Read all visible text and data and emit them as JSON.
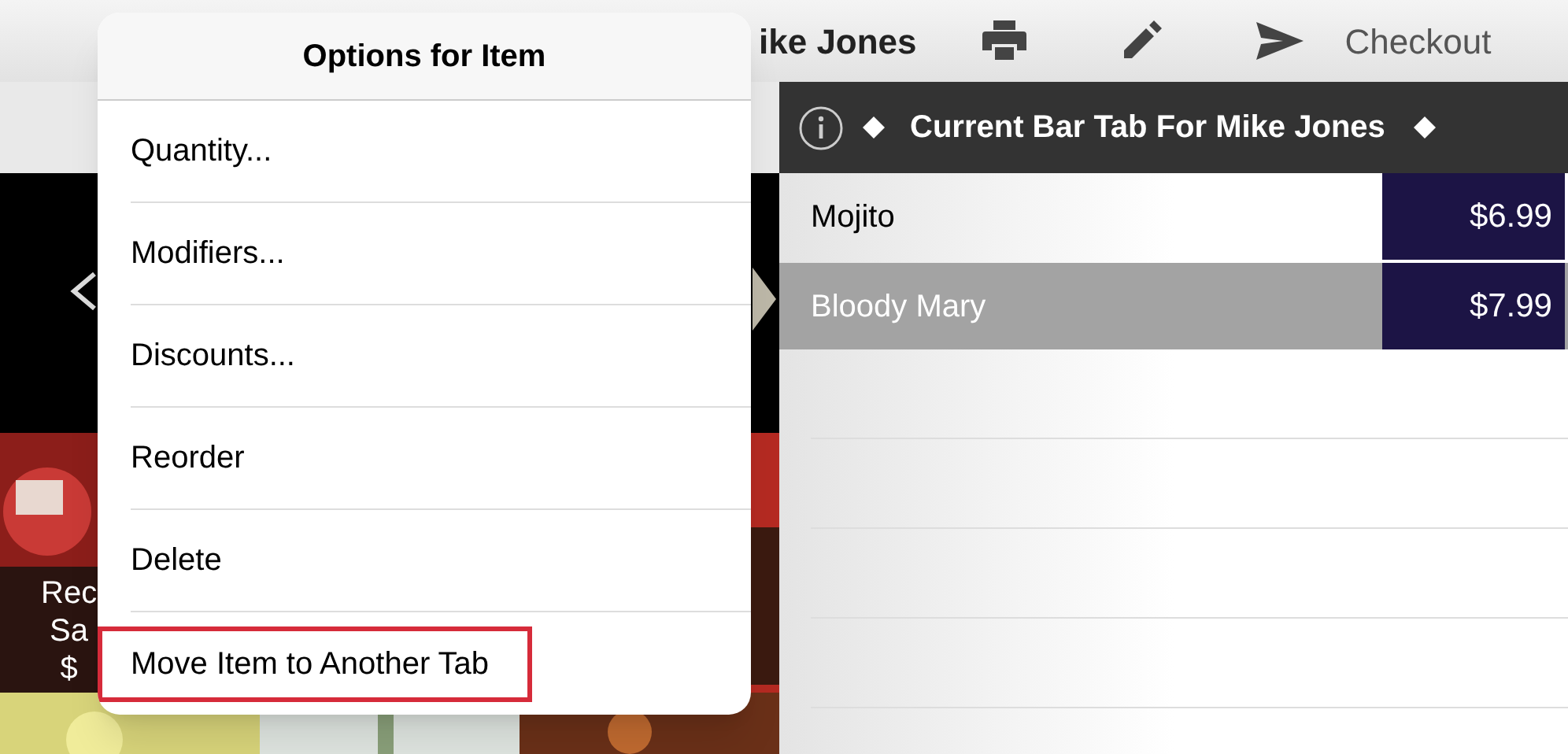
{
  "top_bar": {
    "title": "ike Jones",
    "checkout": "Checkout"
  },
  "menu_tiles": [
    {
      "caption_lines": [
        "Rec",
        "Sa",
        "$"
      ]
    }
  ],
  "tab_panel": {
    "title": "Current Bar Tab For Mike Jones",
    "items": [
      {
        "name": "Mojito",
        "price": "$6.99",
        "selected": false
      },
      {
        "name": "Bloody Mary",
        "price": "$7.99",
        "selected": true
      }
    ]
  },
  "popover": {
    "title": "Options for Item",
    "options": [
      {
        "label": "Quantity...",
        "highlighted": false
      },
      {
        "label": "Modifiers...",
        "highlighted": false
      },
      {
        "label": "Discounts...",
        "highlighted": false
      },
      {
        "label": "Reorder",
        "highlighted": false
      },
      {
        "label": "Delete",
        "highlighted": false
      },
      {
        "label": "Move Item to Another Tab",
        "highlighted": true
      }
    ]
  }
}
